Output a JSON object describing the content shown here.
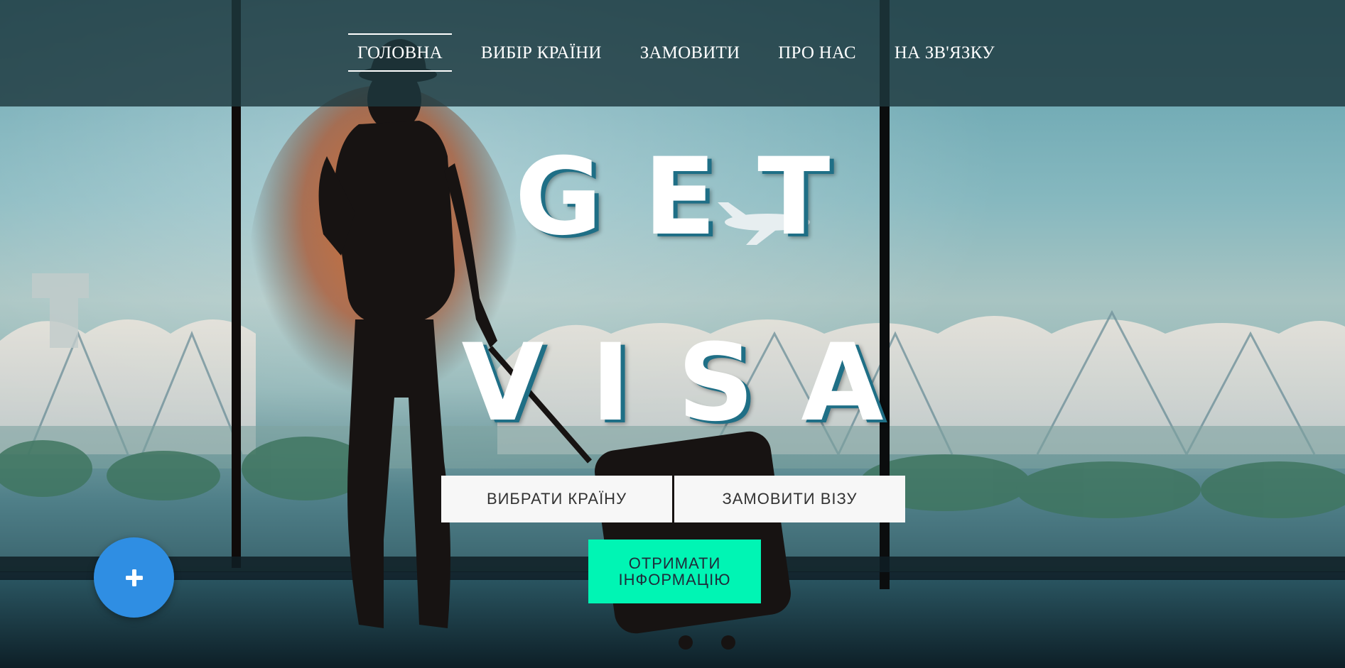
{
  "nav": {
    "items": [
      {
        "label": "ГОЛОВНА",
        "active": true
      },
      {
        "label": "ВИБІР КРАЇНИ",
        "active": false
      },
      {
        "label": "ЗАМОВИТИ",
        "active": false
      },
      {
        "label": "ПРО НАС",
        "active": false
      },
      {
        "label": "НА ЗВ'ЯЗКУ",
        "active": false
      }
    ]
  },
  "hero": {
    "line1": "GET",
    "line2": "VISA"
  },
  "buttons": {
    "choose_country": "ВИБРАТИ КРАЇНУ",
    "order_visa": "ЗАМОВИТИ ВІЗУ",
    "get_info": "ОТРИМАТИ ІНФОРМАЦІЮ"
  },
  "fab": {
    "icon": "plus-icon"
  },
  "colors": {
    "nav_bg": "#1d383e",
    "accent": "#00f5b4",
    "fab": "#2f8ee3",
    "title_shadow": "#1f6f86",
    "light_button": "#f7f7f7"
  }
}
